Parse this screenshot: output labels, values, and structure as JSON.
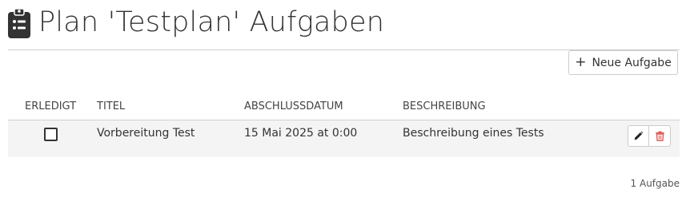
{
  "header": {
    "icon": "clipboard-list-icon",
    "title": "Plan 'Testplan' Aufgaben"
  },
  "toolbar": {
    "new_task_icon": "plus-icon",
    "new_task_label": "Neue Aufgabe"
  },
  "table": {
    "columns": [
      "ERLEDIGT",
      "TITEL",
      "ABSCHLUSSDATUM",
      "BESCHREIBUNG"
    ],
    "rows": [
      {
        "done": false,
        "title": "Vorbereitung Test",
        "due_date": "15 Mai 2025 at 0:00",
        "description": "Beschreibung eines Tests",
        "actions": [
          "pencil-icon",
          "trash-icon"
        ]
      }
    ]
  },
  "footer": {
    "count_text": "1 Aufgabe"
  },
  "colors": {
    "delete_icon": "#d9534f",
    "row_background": "#f4f4f4"
  }
}
